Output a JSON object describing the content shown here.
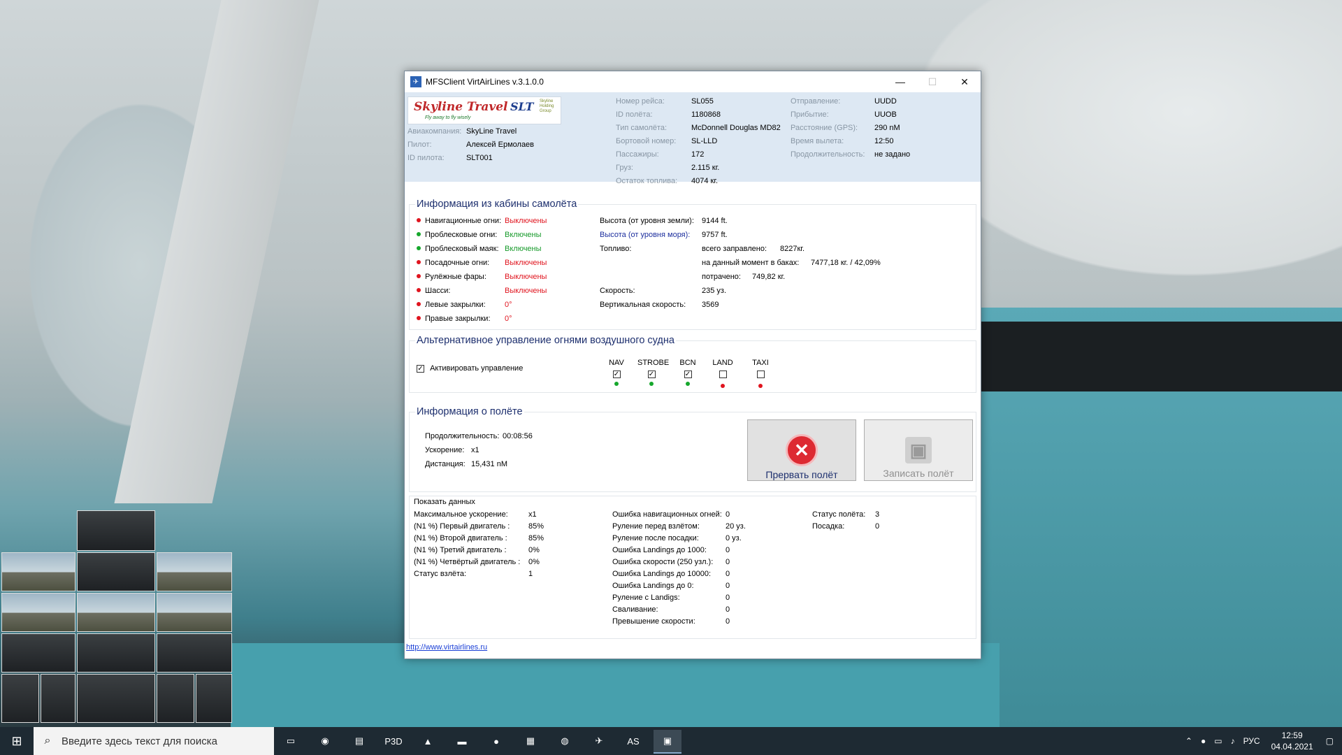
{
  "window": {
    "title": "MFSClient VirtAirLines v.3.1.0.0",
    "minimize": "—",
    "maximize": "☐",
    "close": "✕"
  },
  "logo": {
    "brand": "Skyline Travel",
    "tagline": "Fly away to fly wisely",
    "slt": "SLT",
    "group": "Skyline Holding Group"
  },
  "header": {
    "airline_label": "Авиакомпания:",
    "airline": "SkyLine Travel",
    "pilot_label": "Пилот:",
    "pilot": "Алексей Ермолаев",
    "pilot_id_label": "ID пилота:",
    "pilot_id": "SLT001",
    "flight_no_label": "Номер рейса:",
    "flight_no": "SL055",
    "flight_id_label": "ID полёта:",
    "flight_id": "1180868",
    "aircraft_label": "Тип самолёта:",
    "aircraft": "McDonnell Douglas MD82",
    "tail_label": "Бортовой номер:",
    "tail": "SL-LLD",
    "pax_label": "Пассажиры:",
    "pax": "172",
    "cargo_label": "Груз:",
    "cargo": "2.115 кг.",
    "fuel_rem_label": "Остаток топлива:",
    "fuel_rem": "4074 кг.",
    "dep_label": "Отправление:",
    "dep": "UUDD",
    "arr_label": "Прибытие:",
    "arr": "UUOB",
    "dist_label": "Расстояние (GPS):",
    "dist": "290 nM",
    "dep_time_label": "Время вылета:",
    "dep_time": "12:50",
    "duration_label": "Продолжительность:",
    "duration": "не задано"
  },
  "cockpit": {
    "title": "Информация из кабины самолёта",
    "lights": [
      {
        "label": "Навигационные огни:",
        "value": "Выключены",
        "state": "red"
      },
      {
        "label": "Проблесковые огни:",
        "value": "Включены",
        "state": "green"
      },
      {
        "label": "Проблесковый маяк:",
        "value": "Включены",
        "state": "green"
      },
      {
        "label": "Посадочные огни:",
        "value": "Выключены",
        "state": "red"
      },
      {
        "label": "Рулёжные фары:",
        "value": "Выключены",
        "state": "red"
      },
      {
        "label": "Шасси:",
        "value": "Выключены",
        "state": "red"
      },
      {
        "label": "Левые закрылки:",
        "value": "0°",
        "state": "red"
      },
      {
        "label": "Правые закрылки:",
        "value": "0°",
        "state": "red"
      }
    ],
    "alt_agl_label": "Высота (от уровня земли):",
    "alt_agl": "9144 ft.",
    "alt_msl_label": "Высота (от уровня моря):",
    "alt_msl": "9757 ft.",
    "fuel_label": "Топливо:",
    "fuel_total_label": "всего заправлено:",
    "fuel_total": "8227кг.",
    "fuel_now_label": "на данный момент в баках:",
    "fuel_now": "7477,18 кг. / 42,09%",
    "fuel_used_label": "потрачено:",
    "fuel_used": "749,82 кг.",
    "speed_label": "Скорость:",
    "speed": "235 уз.",
    "vs_label": "Вертикальная скорость:",
    "vs": "3569"
  },
  "alt_lights": {
    "title": "Альтернативное управление огнями воздушного судна",
    "activate_label": "Активировать управление",
    "activate_checked": true,
    "columns": [
      {
        "label": "NAV",
        "checked": true,
        "state": "green"
      },
      {
        "label": "STROBE",
        "checked": true,
        "state": "green"
      },
      {
        "label": "BCN",
        "checked": true,
        "state": "green"
      },
      {
        "label": "LAND",
        "checked": false,
        "state": "red"
      },
      {
        "label": "TAXI",
        "checked": false,
        "state": "red"
      }
    ]
  },
  "flight_info": {
    "title": "Информация о полёте",
    "duration_label": "Продолжительность:",
    "duration": "00:08:56",
    "accel_label": "Ускорение:",
    "accel": "x1",
    "distance_label": "Дистанция:",
    "distance": "15,431 nM",
    "abort_label": "Прервать полёт",
    "save_label": "Записать полёт"
  },
  "stats": {
    "title": "Показать данных",
    "col1": [
      {
        "label": "Максимальное ускорение:",
        "value": "x1"
      },
      {
        "label": "(N1 %) Первый двигатель :",
        "value": "85%"
      },
      {
        "label": "(N1 %) Второй двигатель :",
        "value": "85%"
      },
      {
        "label": "(N1 %) Третий двигатель :",
        "value": "0%"
      },
      {
        "label": "(N1 %) Четвёртый двигатель :",
        "value": "0%"
      },
      {
        "label": "Статус взлёта:",
        "value": "1"
      }
    ],
    "col2": [
      {
        "label": "Ошибка навигационных огней:",
        "value": "0"
      },
      {
        "label": "Руление перед взлётом:",
        "value": "20 уз."
      },
      {
        "label": "Руление после посадки:",
        "value": "0 уз."
      },
      {
        "label": "Ошибка Landings до 1000:",
        "value": "0"
      },
      {
        "label": "Ошибка скорости (250 узл.):",
        "value": "0"
      },
      {
        "label": "Ошибка Landings до 10000:",
        "value": "0"
      },
      {
        "label": "Ошибка Landings до 0:",
        "value": "0"
      },
      {
        "label": "Руление с Landigs:",
        "value": "0"
      },
      {
        "label": "Сваливание:",
        "value": "0"
      },
      {
        "label": "Превышение скорости:",
        "value": "0"
      }
    ],
    "col3": [
      {
        "label": "Статус полёта:",
        "value": "3"
      },
      {
        "label": "Посадка:",
        "value": "0"
      }
    ]
  },
  "link": "http://www.virtairlines.ru",
  "taskbar": {
    "search_placeholder": "Введите здесь текст для поиска",
    "lang": "РУС",
    "time": "12:59",
    "date": "04.04.2021",
    "app_p3d": "P3D",
    "app_as": "AS"
  }
}
